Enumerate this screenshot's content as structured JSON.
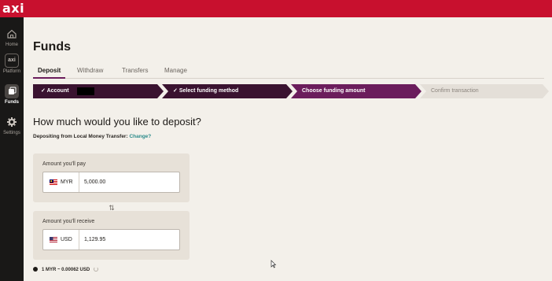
{
  "app": {
    "logo_text": "axi",
    "brand_color": "#c8102e",
    "accent_color": "#6b1d5c"
  },
  "sidebar": {
    "items": [
      {
        "label": "Home",
        "icon": "home-icon",
        "active": false
      },
      {
        "label": "Platform",
        "icon": "platform-icon",
        "icon_text": "axi",
        "active": false
      },
      {
        "label": "Funds",
        "icon": "funds-icon",
        "active": true
      },
      {
        "label": "Settings",
        "icon": "gear-icon",
        "active": false
      }
    ]
  },
  "page": {
    "title": "Funds"
  },
  "tabs": [
    {
      "label": "Deposit",
      "active": true
    },
    {
      "label": "Withdraw",
      "active": false
    },
    {
      "label": "Transfers",
      "active": false
    },
    {
      "label": "Manage",
      "active": false
    }
  ],
  "stepper": [
    {
      "label": "Account",
      "state": "done"
    },
    {
      "label": "Select funding method",
      "state": "done"
    },
    {
      "label": "Choose funding amount",
      "state": "current"
    },
    {
      "label": "Confirm transaction",
      "state": "todo"
    }
  ],
  "deposit": {
    "question": "How much would you like to deposit?",
    "depositing_from": "Depositing from Local Money Transfer:",
    "change_link": "Change?",
    "pay": {
      "label": "Amount you'll pay",
      "currency": "MYR",
      "value": "5,000.00",
      "flag": "malaysia-flag-icon"
    },
    "swap_icon": "swap-arrows-icon",
    "receive": {
      "label": "Amount you'll receive",
      "currency": "USD",
      "value": "1,129.95",
      "flag": "us-flag-icon"
    },
    "rate": "1 MYR ~ 0.00062 USD"
  }
}
